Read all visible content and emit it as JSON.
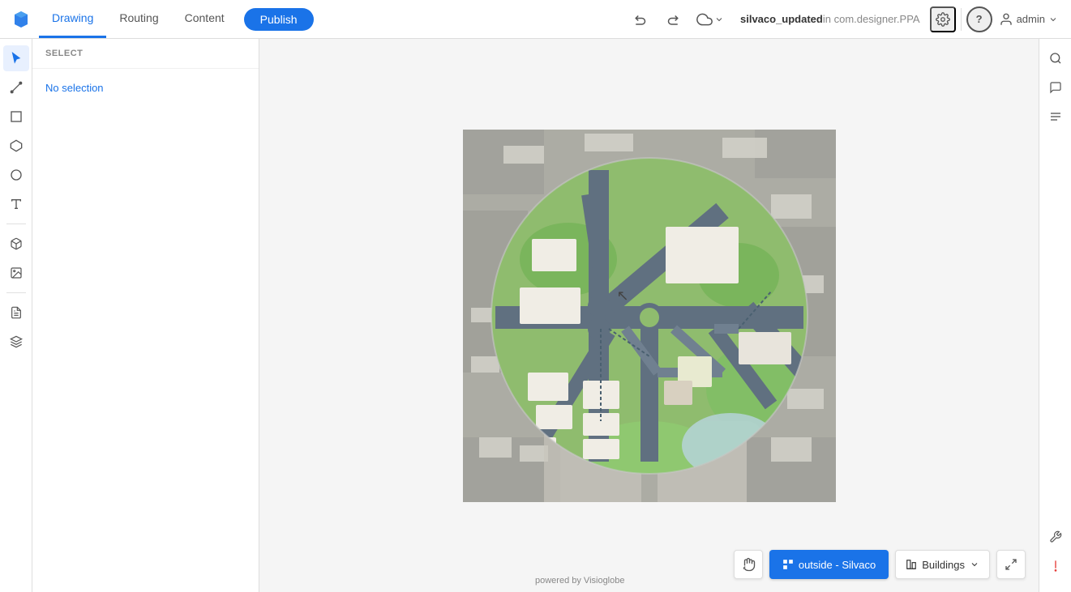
{
  "topbar": {
    "tabs": [
      {
        "id": "drawing",
        "label": "Drawing",
        "active": true
      },
      {
        "id": "routing",
        "label": "Routing",
        "active": false
      },
      {
        "id": "content",
        "label": "Content",
        "active": false
      }
    ],
    "publish_label": "Publish",
    "project_name": "silvaco_updated",
    "project_suffix": " in com.designer.PPA",
    "help_label": "?",
    "user_label": "admin"
  },
  "left_panel": {
    "select_label": "SELECT",
    "no_selection_label": "No selection",
    "tools": [
      {
        "id": "pointer",
        "icon": "pointer"
      },
      {
        "id": "line",
        "icon": "line"
      },
      {
        "id": "rectangle",
        "icon": "rectangle"
      },
      {
        "id": "polygon",
        "icon": "polygon"
      },
      {
        "id": "circle",
        "icon": "circle"
      },
      {
        "id": "text",
        "icon": "text"
      },
      {
        "id": "box3d",
        "icon": "box3d"
      },
      {
        "id": "image",
        "icon": "image"
      },
      {
        "id": "document",
        "icon": "document"
      },
      {
        "id": "layers",
        "icon": "layers"
      }
    ]
  },
  "bottom_bar": {
    "location_label": "outside - Silvaco",
    "buildings_label": "Buildings",
    "powered_by": "powered by Visioglobe"
  },
  "map": {
    "colors": {
      "background": "#b8b8b8",
      "green": "#7cb87c",
      "road": "#607d8b",
      "building_white": "#f5f5f0",
      "building_tan": "#e8e0d0",
      "water": "#a8c8d8",
      "circle_border": "rgba(255,255,255,0.3)"
    }
  }
}
